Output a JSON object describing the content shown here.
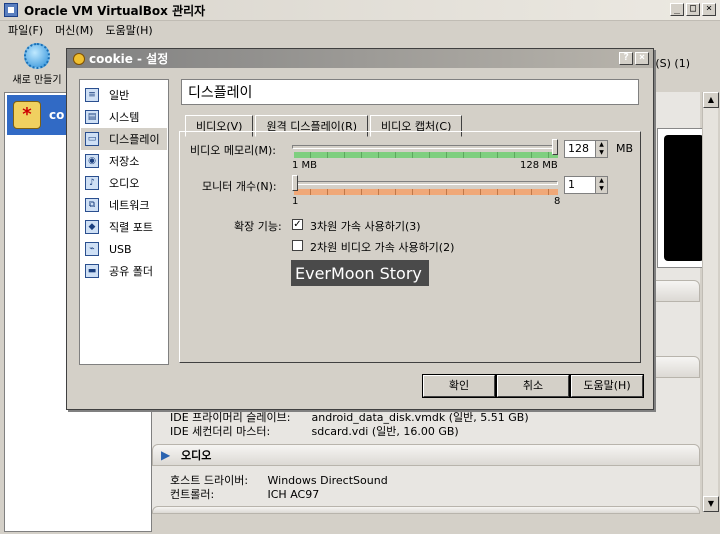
{
  "main": {
    "title": "Oracle VM VirtualBox 관리자",
    "menu": [
      "파일(F)",
      "머신(M)",
      "도움말(H)"
    ],
    "toolbar": {
      "new_label": "새로 만들기",
      "right_fragment": "(S) (1)"
    },
    "vm": {
      "name": "co"
    },
    "storage": [
      {
        "key": "IDE 프라이머리 슬레이브:",
        "value": "android_data_disk.vmdk (일반, 5.51 GB)"
      },
      {
        "key": "IDE 세컨더리 마스터:",
        "value": "sdcard.vdi (일반, 16.00 GB)"
      }
    ],
    "audio": {
      "header": "오디오",
      "rows": [
        {
          "key": "호스트 드라이버:",
          "value": "Windows DirectSound"
        },
        {
          "key": "컨트롤러:",
          "value": "ICH AC97"
        }
      ]
    }
  },
  "dialog": {
    "title": "cookie - 설정",
    "categories": [
      "일반",
      "시스템",
      "디스플레이",
      "저장소",
      "오디오",
      "네트워크",
      "직렬 포트",
      "USB",
      "공유 폴더"
    ],
    "selected_category": "디스플레이",
    "section_title": "디스플레이",
    "tabs": [
      "비디오(V)",
      "원격 디스플레이(R)",
      "비디오 캡처(C)"
    ],
    "video_memory": {
      "label": "비디오 메모리(M):",
      "value": "128",
      "unit": "MB",
      "min_label": "1 MB",
      "max_label": "128 MB",
      "level": 1.0
    },
    "monitors": {
      "label": "모니터 개수(N):",
      "value": "1",
      "min_label": "1",
      "max_label": "8",
      "level": 0.0
    },
    "extended": {
      "label": "확장 기능:",
      "accel3d": {
        "label": "3차원 가속 사용하기(3)",
        "checked": true
      },
      "accel2d": {
        "label": "2차원 비디오 가속 사용하기(2)",
        "checked": false
      }
    },
    "watermark": "EverMoon Story",
    "buttons": {
      "ok": "확인",
      "cancel": "취소",
      "help": "도움말(H)"
    }
  }
}
